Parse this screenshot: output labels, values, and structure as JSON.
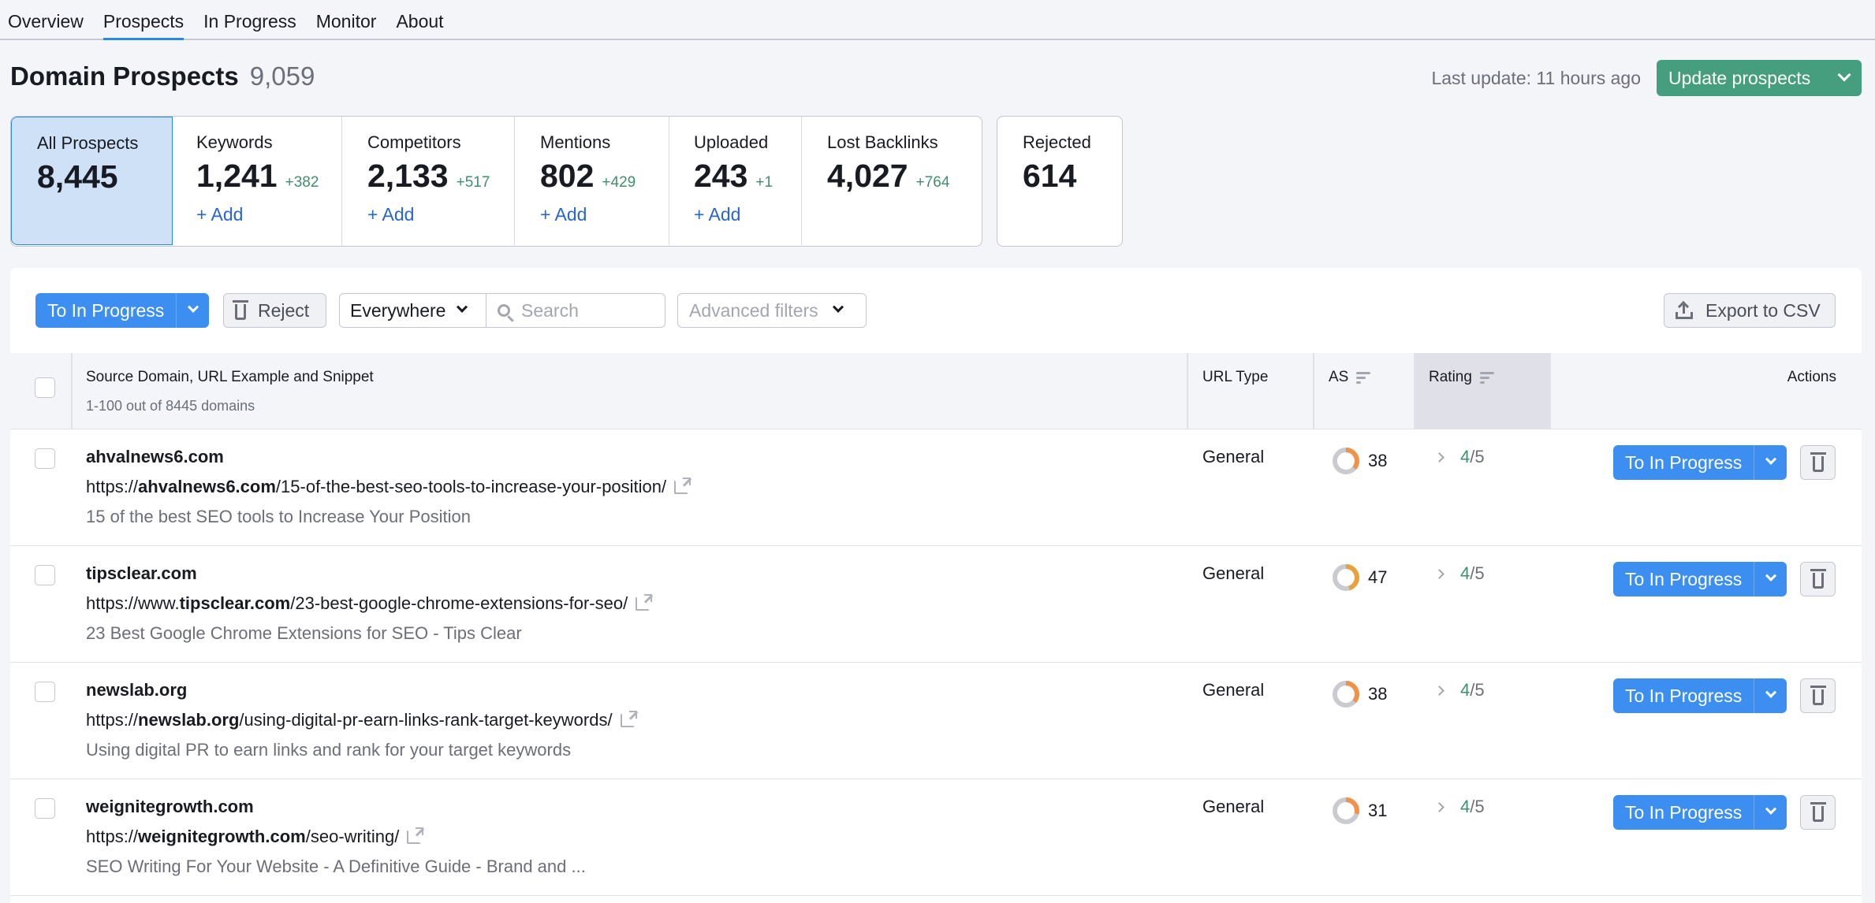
{
  "nav": {
    "tabs": [
      {
        "label": "Overview",
        "active": false
      },
      {
        "label": "Prospects",
        "active": true
      },
      {
        "label": "In Progress",
        "active": false
      },
      {
        "label": "Monitor",
        "active": false
      },
      {
        "label": "About",
        "active": false
      }
    ]
  },
  "header": {
    "title": "Domain Prospects",
    "count": "9,059",
    "last_update": "Last update: 11 hours ago",
    "update_button": "Update prospects"
  },
  "cards": [
    {
      "label": "All Prospects",
      "value": "8,445",
      "delta": "",
      "add": "",
      "active": true
    },
    {
      "label": "Keywords",
      "value": "1,241",
      "delta": "+382",
      "add": "+ Add"
    },
    {
      "label": "Competitors",
      "value": "2,133",
      "delta": "+517",
      "add": "+ Add"
    },
    {
      "label": "Mentions",
      "value": "802",
      "delta": "+429",
      "add": "+ Add"
    },
    {
      "label": "Uploaded",
      "value": "243",
      "delta": "+1",
      "add": "+ Add"
    },
    {
      "label": "Lost Backlinks",
      "value": "4,027",
      "delta": "+764",
      "add": ""
    },
    {
      "label": "Rejected",
      "value": "614",
      "delta": "",
      "add": ""
    }
  ],
  "toolbar": {
    "to_in_progress": "To In Progress",
    "reject": "Reject",
    "scope": "Everywhere",
    "search_placeholder": "Search",
    "search_value": "",
    "advanced_filters": "Advanced filters",
    "export": "Export to CSV"
  },
  "table": {
    "columns": {
      "source": "Source Domain, URL Example and Snippet",
      "source_sub": "1-100 out of 8445 domains",
      "url_type": "URL Type",
      "as": "AS",
      "rating": "Rating",
      "actions": "Actions"
    },
    "rows": [
      {
        "domain": "ahvalnews6.com",
        "url_prefix": "https://",
        "url_domain": "ahvalnews6.com",
        "url_path": "/15-of-the-best-seo-tools-to-increase-your-position/",
        "snippet": "15 of the best SEO tools to Increase Your Position",
        "url_type": "General",
        "as": 38,
        "rating_value": "4",
        "rating_max": "/5",
        "action": "To In Progress"
      },
      {
        "domain": "tipsclear.com",
        "url_prefix": "https://www.",
        "url_domain": "tipsclear.com",
        "url_path": "/23-best-google-chrome-extensions-for-seo/",
        "snippet": "23 Best Google Chrome Extensions for SEO - Tips Clear",
        "url_type": "General",
        "as": 47,
        "rating_value": "4",
        "rating_max": "/5",
        "action": "To In Progress"
      },
      {
        "domain": "newslab.org",
        "url_prefix": "https://",
        "url_domain": "newslab.org",
        "url_path": "/using-digital-pr-earn-links-rank-target-keywords/",
        "snippet": "Using digital PR to earn links and rank for your target keywords",
        "url_type": "General",
        "as": 38,
        "rating_value": "4",
        "rating_max": "/5",
        "action": "To In Progress"
      },
      {
        "domain": "weignitegrowth.com",
        "url_prefix": "https://",
        "url_domain": "weignitegrowth.com",
        "url_path": "/seo-writing/",
        "snippet": "SEO Writing For Your Website - A Definitive Guide - Brand and ...",
        "url_type": "General",
        "as": 31,
        "rating_value": "4",
        "rating_max": "/5",
        "action": "To In Progress"
      }
    ]
  },
  "colors": {
    "accent": "#3c8ff0",
    "update_green": "#459f7f",
    "delta_green": "#3f8f6e",
    "as_orange": "#f0924a",
    "as_amber": "#e9a23b",
    "as_track": "#c9cbd1",
    "link_blue": "#2866c9"
  }
}
